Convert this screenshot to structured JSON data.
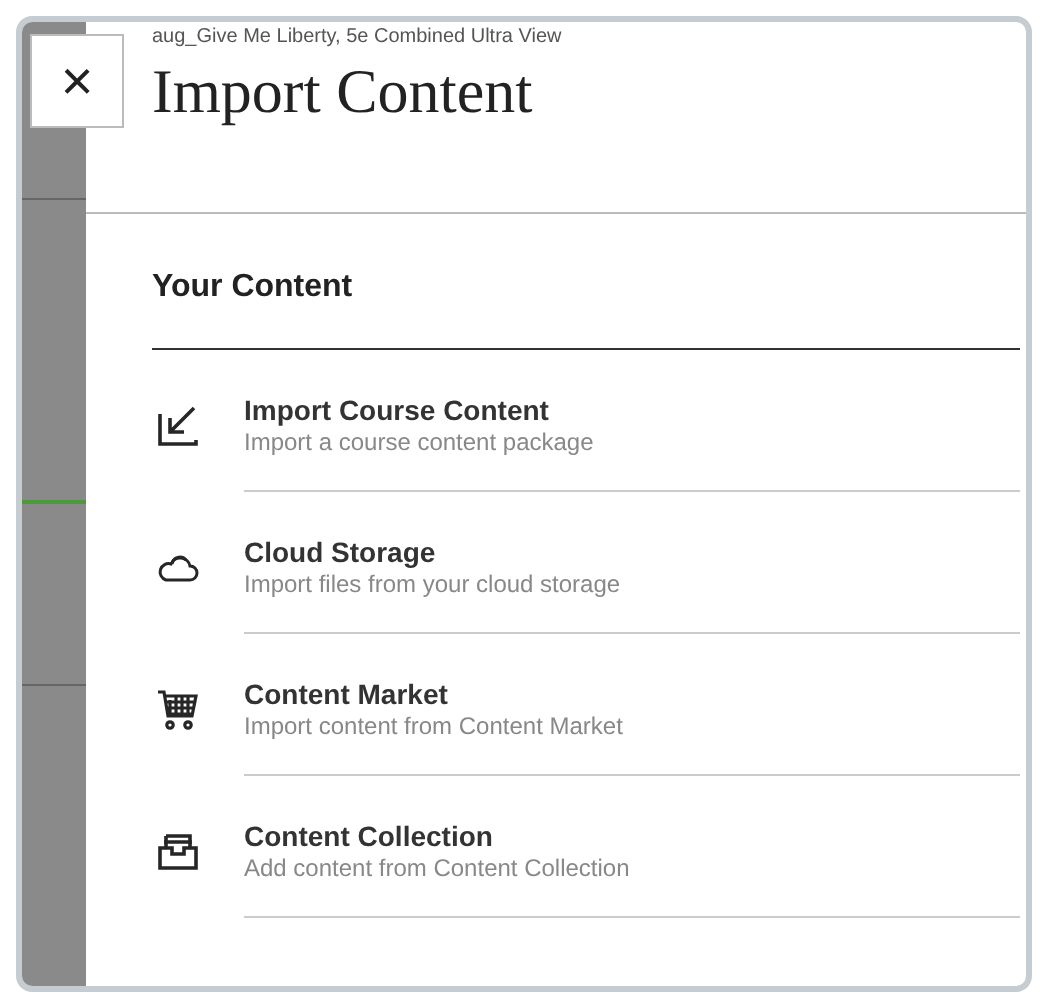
{
  "panel": {
    "breadcrumb": "aug_Give Me Liberty, 5e Combined Ultra View",
    "title": "Import Content",
    "close_label": "×"
  },
  "section": {
    "heading": "Your Content",
    "items": [
      {
        "kind": "import",
        "title": "Import Course Content",
        "description": "Import a course content package"
      },
      {
        "kind": "cloud",
        "title": "Cloud Storage",
        "description": "Import files from your cloud storage"
      },
      {
        "kind": "market",
        "title": "Content Market",
        "description": "Import content from Content Market"
      },
      {
        "kind": "collection",
        "title": "Content Collection",
        "description": "Add content from Content Collection"
      }
    ]
  }
}
